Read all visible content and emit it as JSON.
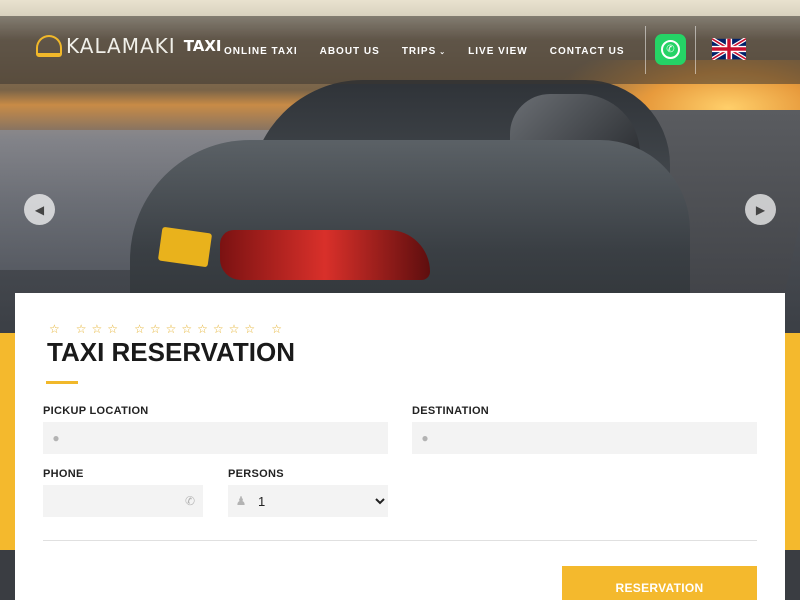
{
  "header": {
    "logo_name": "KALAMAKI",
    "logo_taxi": "TAXI",
    "nav": [
      {
        "label": "ONLINE TAXI"
      },
      {
        "label": "ABOUT US"
      },
      {
        "label": "TRIPS",
        "has_dropdown": true
      },
      {
        "label": "LIVE VIEW"
      },
      {
        "label": "CONTACT US"
      }
    ],
    "whatsapp_icon": "whatsapp-icon",
    "language_flag": "uk-flag-icon"
  },
  "hero": {
    "prev_icon": "chevron-left-icon",
    "next_icon": "chevron-right-icon"
  },
  "form": {
    "star_count": 13,
    "title": "TAXI RESERVATION",
    "pickup": {
      "label": "PICKUP LOCATION",
      "value": "",
      "icon": "map-marker-icon"
    },
    "destination": {
      "label": "DESTINATION",
      "value": "",
      "icon": "map-marker-icon"
    },
    "phone": {
      "label": "PHONE",
      "value": "",
      "icon": "phone-icon"
    },
    "persons": {
      "label": "PERSONS",
      "value": "1",
      "icon": "user-icon"
    },
    "submit_label": "RESERVATION"
  },
  "colors": {
    "accent": "#f4b92d",
    "whatsapp": "#25d366",
    "dark": "#3a3d42"
  }
}
